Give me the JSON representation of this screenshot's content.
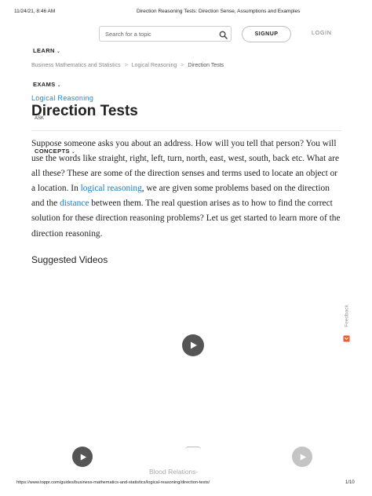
{
  "print_header": {
    "datetime": "11/24/21, 8:46 AM",
    "page_title": "Direction Reasoning Tests: Direction Sense, Assumptions and Examples"
  },
  "header": {
    "search_placeholder": "Search for a topic",
    "signup_label": "SIGNUP",
    "login_label": "LOGIN"
  },
  "nav": {
    "learn_label": "LEARN",
    "exams_label": "EXAMS",
    "concepts_label": "CONCEPTS",
    "ask_label": "ASK"
  },
  "breadcrumb": {
    "items": [
      "Business Mathematics and Statistics",
      "Logical Reasoning",
      "Direction Tests"
    ],
    "separator": ">"
  },
  "article": {
    "category": "Logical Reasoning",
    "title": "Direction Tests",
    "para_part1": "Suppose someone asks you about an address. How will you tell that person? You will use the words like straight, right, left, turn, north, east, west, south, back etc. What are all these? These are some of the direction senses and terms used to locate an object or a location. In ",
    "link1": "logical reasoning",
    "para_part2": ", we are given some problems based on the direction and the ",
    "link2": "distance",
    "para_part3": " between them. The real question arises as to how to find the correct solution for these direction reasoning problems? Let us get started to learn more of the direction reasoning.",
    "suggested_heading": "Suggested Videos"
  },
  "video": {
    "next_title": "Blood Relations-"
  },
  "feedback": {
    "label": "Feedback"
  },
  "print_footer": {
    "url": "https://www.toppr.com/guides/business-mathematics-and-statistics/logical-reasoning/direction-tests/",
    "page": "1/10"
  },
  "colors": {
    "link": "#1f7bb6",
    "category": "#1f8bc4",
    "play_button": "#555555",
    "feedback_icon": "#e8613c"
  }
}
